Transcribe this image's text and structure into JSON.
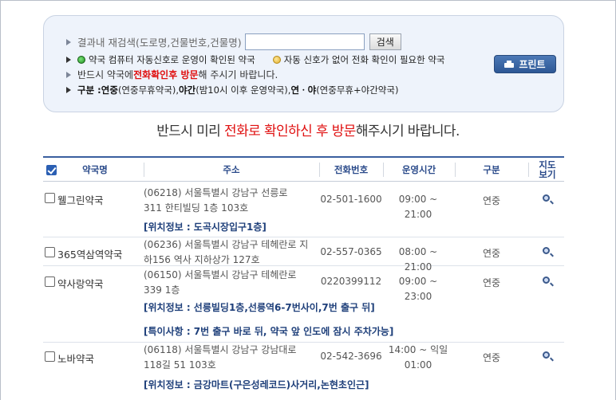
{
  "search": {
    "label": "결과내 재검색(도로명,건물번호,건물명)",
    "value": "",
    "placeholder": "",
    "button": "검색"
  },
  "legend": {
    "auto": "약국 컴퓨터 자동신호로 운영이 확인된 약국",
    "manual": "자동 신호가 없어 전화 확인이 필요한 약국",
    "colors": {
      "auto": "#22a022",
      "manual": "#e8b53a"
    }
  },
  "visit_note": {
    "prefix": "반드시 약국에 ",
    "highlight": "전화확인후 방문",
    "suffix": "해 주시기 바랍니다."
  },
  "category_note": {
    "label": "구분 : ",
    "t1": "연중",
    "d1": "(연중무휴약국), ",
    "t2": "야간",
    "d2": "(밤10시 이후 운영약국), ",
    "t3": "연ㆍ야",
    "d3": "(연중무휴+야간약국)"
  },
  "print_button": "프린트",
  "notice": {
    "prefix": "반드시 미리 ",
    "highlight": "전화로 확인하신 후 방문",
    "suffix": "해주시기 바랍니다."
  },
  "table": {
    "headers": {
      "name": "약국명",
      "address": "주소",
      "phone": "전화번호",
      "hours": "운영시간",
      "category": "구분",
      "map_line1": "지도",
      "map_line2": "보기"
    },
    "rows": [
      {
        "name": "웰그린약국",
        "addr1": "(06218) 서울특별시 강남구 선릉로",
        "addr2": "311 한티빌딩 1층 103호",
        "phone": "02-501-1600",
        "hours1": "09:00 ~ 21:00",
        "hours2": "",
        "category": "연중",
        "extra1": "[위치정보 : 도곡시장입구1층]",
        "extra2": ""
      },
      {
        "name": "365역삼역약국",
        "addr1": "(06236) 서울특별시 강남구 테헤란로 지",
        "addr2": "하156 역사 지하상가 127호",
        "phone": "02-557-0365",
        "hours1": "08:00 ~ 21:00",
        "hours2": "",
        "category": "연중",
        "extra1": "",
        "extra2": ""
      },
      {
        "name": "약사랑약국",
        "addr1": "(06150) 서울특별시 강남구 테헤란로",
        "addr2": "339 1층",
        "phone": "0220399112",
        "hours1": "09:00 ~ 23:00",
        "hours2": "",
        "category": "연중",
        "extra1": "[위치정보 : 선릉빌딩1층,선릉역6-7번사이,7번 출구 뒤]",
        "extra2": "[특이사항 : 7번 출구 바로 뒤, 약국 앞 인도에 잠시 주차가능]"
      },
      {
        "name": "노바약국",
        "addr1": "(06118) 서울특별시 강남구 강남대로",
        "addr2": "118길 51 103호",
        "phone": "02-542-3696",
        "hours1": "14:00 ~ 익일",
        "hours2": "01:00",
        "category": "연중",
        "extra1": "[위치정보 : 금강마트(구은성레코드)사거리,논현초인근]",
        "extra2": ""
      }
    ]
  }
}
